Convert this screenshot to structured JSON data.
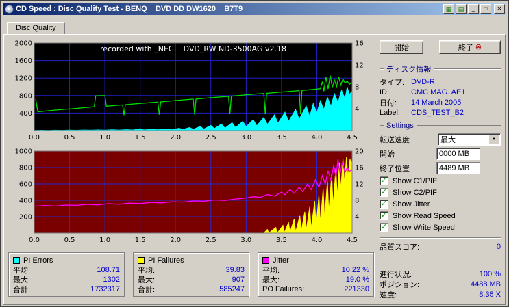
{
  "window": {
    "title": "CD Speed : Disc Quality Test - BENQ    DVD DD DW1620    B7T9",
    "buttons": {
      "minimize": "_",
      "maximize": "□",
      "close": "✕",
      "extra1": "▦",
      "extra2": "▤"
    }
  },
  "tabs": [
    {
      "label": "Disc Quality"
    }
  ],
  "chart_data": [
    {
      "type": "area",
      "title": "PI Errors / Read Speed",
      "annotation": "recorded with _NEC    DVD_RW ND-3500AG v2.18",
      "bg": "#000000",
      "grid": "#2121c8",
      "xlim": [
        0,
        4.5
      ],
      "ylim": [
        0,
        2000
      ],
      "right_max": 16,
      "x_ticks": [
        0,
        0.5,
        1,
        1.5,
        2,
        2.5,
        3,
        3.5,
        4,
        4.5
      ],
      "y_ticks": [
        400,
        800,
        1200,
        1600,
        2000
      ],
      "right_ticks": [
        4,
        8,
        12,
        16
      ],
      "series": [
        {
          "name": "PI Errors",
          "color": "#00ffff",
          "type": "area",
          "points": [
            [
              0,
              4
            ],
            [
              0.1,
              8
            ],
            [
              0.2,
              5
            ],
            [
              0.3,
              10
            ],
            [
              0.4,
              6
            ],
            [
              0.5,
              12
            ],
            [
              0.6,
              8
            ],
            [
              0.7,
              14
            ],
            [
              0.8,
              9
            ],
            [
              0.9,
              16
            ],
            [
              1.0,
              10
            ],
            [
              1.1,
              18
            ],
            [
              1.2,
              12
            ],
            [
              1.3,
              22
            ],
            [
              1.4,
              14
            ],
            [
              1.5,
              45
            ],
            [
              1.55,
              15
            ],
            [
              1.65,
              28
            ],
            [
              1.75,
              18
            ],
            [
              1.85,
              35
            ],
            [
              1.95,
              20
            ],
            [
              2.05,
              55
            ],
            [
              2.1,
              25
            ],
            [
              2.2,
              70
            ],
            [
              2.25,
              30
            ],
            [
              2.35,
              95
            ],
            [
              2.4,
              35
            ],
            [
              2.5,
              120
            ],
            [
              2.55,
              45
            ],
            [
              2.65,
              150
            ],
            [
              2.7,
              55
            ],
            [
              2.8,
              180
            ],
            [
              2.85,
              70
            ],
            [
              2.95,
              210
            ],
            [
              3.0,
              90
            ],
            [
              3.1,
              250
            ],
            [
              3.15,
              110
            ],
            [
              3.25,
              300
            ],
            [
              3.3,
              140
            ],
            [
              3.4,
              360
            ],
            [
              3.45,
              170
            ],
            [
              3.55,
              420
            ],
            [
              3.6,
              210
            ],
            [
              3.7,
              480
            ],
            [
              3.75,
              260
            ],
            [
              3.85,
              560
            ],
            [
              3.9,
              320
            ],
            [
              3.95,
              620
            ],
            [
              4.0,
              400
            ],
            [
              4.05,
              680
            ],
            [
              4.1,
              480
            ],
            [
              4.15,
              760
            ],
            [
              4.2,
              560
            ],
            [
              4.25,
              840
            ],
            [
              4.3,
              640
            ],
            [
              4.35,
              920
            ],
            [
              4.4,
              720
            ],
            [
              4.43,
              1000
            ],
            [
              4.46,
              820
            ],
            [
              4.5,
              900
            ]
          ]
        },
        {
          "name": "Read Speed",
          "color": "#00dd00",
          "type": "line",
          "points": [
            [
              0.02,
              720
            ],
            [
              0.05,
              430
            ],
            [
              0.3,
              468
            ],
            [
              0.6,
              508
            ],
            [
              0.85,
              545
            ],
            [
              0.87,
              795
            ],
            [
              1.0,
              800
            ],
            [
              1.02,
              558
            ],
            [
              1.25,
              588
            ],
            [
              1.27,
              355
            ],
            [
              1.29,
              592
            ],
            [
              1.5,
              622
            ],
            [
              1.75,
              652
            ],
            [
              1.77,
              362
            ],
            [
              1.79,
              656
            ],
            [
              2.0,
              688
            ],
            [
              2.25,
              718
            ],
            [
              2.27,
              368
            ],
            [
              2.29,
              722
            ],
            [
              2.5,
              752
            ],
            [
              2.75,
              782
            ],
            [
              2.77,
              375
            ],
            [
              2.79,
              786
            ],
            [
              3.0,
              818
            ],
            [
              3.25,
              848
            ],
            [
              3.27,
              382
            ],
            [
              3.29,
              852
            ],
            [
              3.5,
              882
            ],
            [
              3.75,
              912
            ],
            [
              3.77,
              390
            ],
            [
              3.79,
              916
            ],
            [
              4.0,
              948
            ],
            [
              4.05,
              958
            ],
            [
              4.08,
              1120
            ],
            [
              4.1,
              900
            ],
            [
              4.13,
              1230
            ],
            [
              4.16,
              950
            ],
            [
              4.19,
              1260
            ],
            [
              4.22,
              990
            ],
            [
              4.25,
              1160
            ],
            [
              4.28,
              1010
            ],
            [
              4.31,
              1230
            ],
            [
              4.34,
              1040
            ],
            [
              4.37,
              1180
            ],
            [
              4.4,
              1080
            ],
            [
              4.43,
              1130
            ],
            [
              4.46,
              1060
            ],
            [
              4.5,
              1090
            ]
          ]
        }
      ]
    },
    {
      "type": "area",
      "title": "PI Failures / Jitter",
      "bg": "#7a0000",
      "grid": "#2828d0",
      "xlim": [
        0,
        4.5
      ],
      "ylim": [
        0,
        1000
      ],
      "right_max": 20,
      "x_ticks": [
        0,
        0.5,
        1,
        1.5,
        2,
        2.5,
        3,
        3.5,
        4,
        4.5
      ],
      "y_ticks": [
        200,
        400,
        600,
        800,
        1000
      ],
      "right_ticks": [
        4,
        8,
        12,
        16,
        20
      ],
      "series": [
        {
          "name": "PI Failures",
          "color": "#ffff00",
          "type": "area",
          "points": [
            [
              0,
              0
            ],
            [
              3.25,
              0
            ],
            [
              3.3,
              45
            ],
            [
              3.32,
              0
            ],
            [
              3.42,
              70
            ],
            [
              3.44,
              0
            ],
            [
              3.52,
              95
            ],
            [
              3.54,
              5
            ],
            [
              3.6,
              130
            ],
            [
              3.62,
              10
            ],
            [
              3.68,
              170
            ],
            [
              3.7,
              15
            ],
            [
              3.76,
              210
            ],
            [
              3.78,
              25
            ],
            [
              3.83,
              260
            ],
            [
              3.85,
              35
            ],
            [
              3.9,
              320
            ],
            [
              3.92,
              50
            ],
            [
              3.97,
              390
            ],
            [
              3.99,
              80
            ],
            [
              4.03,
              460
            ],
            [
              4.05,
              120
            ],
            [
              4.09,
              540
            ],
            [
              4.11,
              180
            ],
            [
              4.15,
              630
            ],
            [
              4.17,
              250
            ],
            [
              4.21,
              720
            ],
            [
              4.23,
              330
            ],
            [
              4.27,
              800
            ],
            [
              4.29,
              430
            ],
            [
              4.32,
              860
            ],
            [
              4.34,
              520
            ],
            [
              4.37,
              910
            ],
            [
              4.39,
              600
            ],
            [
              4.42,
              930
            ],
            [
              4.44,
              680
            ],
            [
              4.47,
              900
            ],
            [
              4.5,
              850
            ]
          ]
        },
        {
          "name": "Jitter",
          "color": "#ff00ff",
          "type": "line",
          "points": [
            [
              0,
              328
            ],
            [
              0.15,
              336
            ],
            [
              0.3,
              330
            ],
            [
              0.45,
              342
            ],
            [
              0.6,
              338
            ],
            [
              0.75,
              350
            ],
            [
              0.9,
              344
            ],
            [
              1.05,
              358
            ],
            [
              1.2,
              352
            ],
            [
              1.35,
              366
            ],
            [
              1.5,
              360
            ],
            [
              1.65,
              374
            ],
            [
              1.8,
              368
            ],
            [
              1.95,
              382
            ],
            [
              2.1,
              378
            ],
            [
              2.25,
              392
            ],
            [
              2.4,
              388
            ],
            [
              2.55,
              404
            ],
            [
              2.7,
              398
            ],
            [
              2.85,
              416
            ],
            [
              3.0,
              428
            ],
            [
              3.1,
              444
            ],
            [
              3.2,
              436
            ],
            [
              3.3,
              470
            ],
            [
              3.4,
              452
            ],
            [
              3.5,
              500
            ],
            [
              3.55,
              468
            ],
            [
              3.62,
              530
            ],
            [
              3.68,
              486
            ],
            [
              3.75,
              560
            ],
            [
              3.8,
              506
            ],
            [
              3.87,
              600
            ],
            [
              3.92,
              530
            ],
            [
              3.98,
              650
            ],
            [
              4.03,
              560
            ],
            [
              4.08,
              700
            ],
            [
              4.12,
              600
            ],
            [
              4.16,
              760
            ],
            [
              4.2,
              640
            ],
            [
              4.24,
              830
            ],
            [
              4.27,
              680
            ],
            [
              4.3,
              900
            ],
            [
              4.33,
              720
            ],
            [
              4.36,
              860
            ],
            [
              4.4,
              740
            ],
            [
              4.43,
              800
            ],
            [
              4.46,
              756
            ],
            [
              4.5,
              768
            ]
          ]
        }
      ]
    }
  ],
  "legend": [
    {
      "title": "PI Errors",
      "color": "#00ffff",
      "rows": [
        [
          "平均:",
          "108.71"
        ],
        [
          "最大:",
          "1302"
        ],
        [
          "合計:",
          "1732317"
        ]
      ]
    },
    {
      "title": "PI Failures",
      "color": "#ffff00",
      "rows": [
        [
          "平均:",
          "39.83"
        ],
        [
          "最大:",
          "907"
        ],
        [
          "合計:",
          "585247"
        ]
      ]
    },
    {
      "title": "Jitter",
      "color": "#ff00ff",
      "rows": [
        [
          "平均:",
          "10.22 %"
        ],
        [
          "最大:",
          "19.0 %"
        ],
        [
          "PO Failures:",
          "221330"
        ]
      ]
    }
  ],
  "panel": {
    "start_button": "開始",
    "exit_button": "終了",
    "disc_info": {
      "header": "ディスク情報",
      "rows": [
        [
          "タイプ:",
          "DVD-R"
        ],
        [
          "ID:",
          "CMC MAG. AE1"
        ],
        [
          "日付:",
          "14 March 2005"
        ],
        [
          "Label:",
          "CDS_TEST_B2"
        ]
      ]
    },
    "settings": {
      "header": "Settings",
      "speed_label": "転送速度",
      "speed_value": "最大",
      "start_label": "開始",
      "start_value": "0000 MB",
      "end_label": "終了位置",
      "end_value": "4489 MB",
      "checkboxes": [
        "Show C1/PIE",
        "Show C2/PIF",
        "Show Jitter",
        "Show Read Speed",
        "Show Write Speed"
      ],
      "score_label": "品質スコア:",
      "score_value": "0"
    },
    "status": {
      "rows": [
        [
          "進行状況:",
          "100 %"
        ],
        [
          "ポジション:",
          "4488 MB"
        ],
        [
          "速度:",
          "8.35 X"
        ]
      ]
    }
  }
}
